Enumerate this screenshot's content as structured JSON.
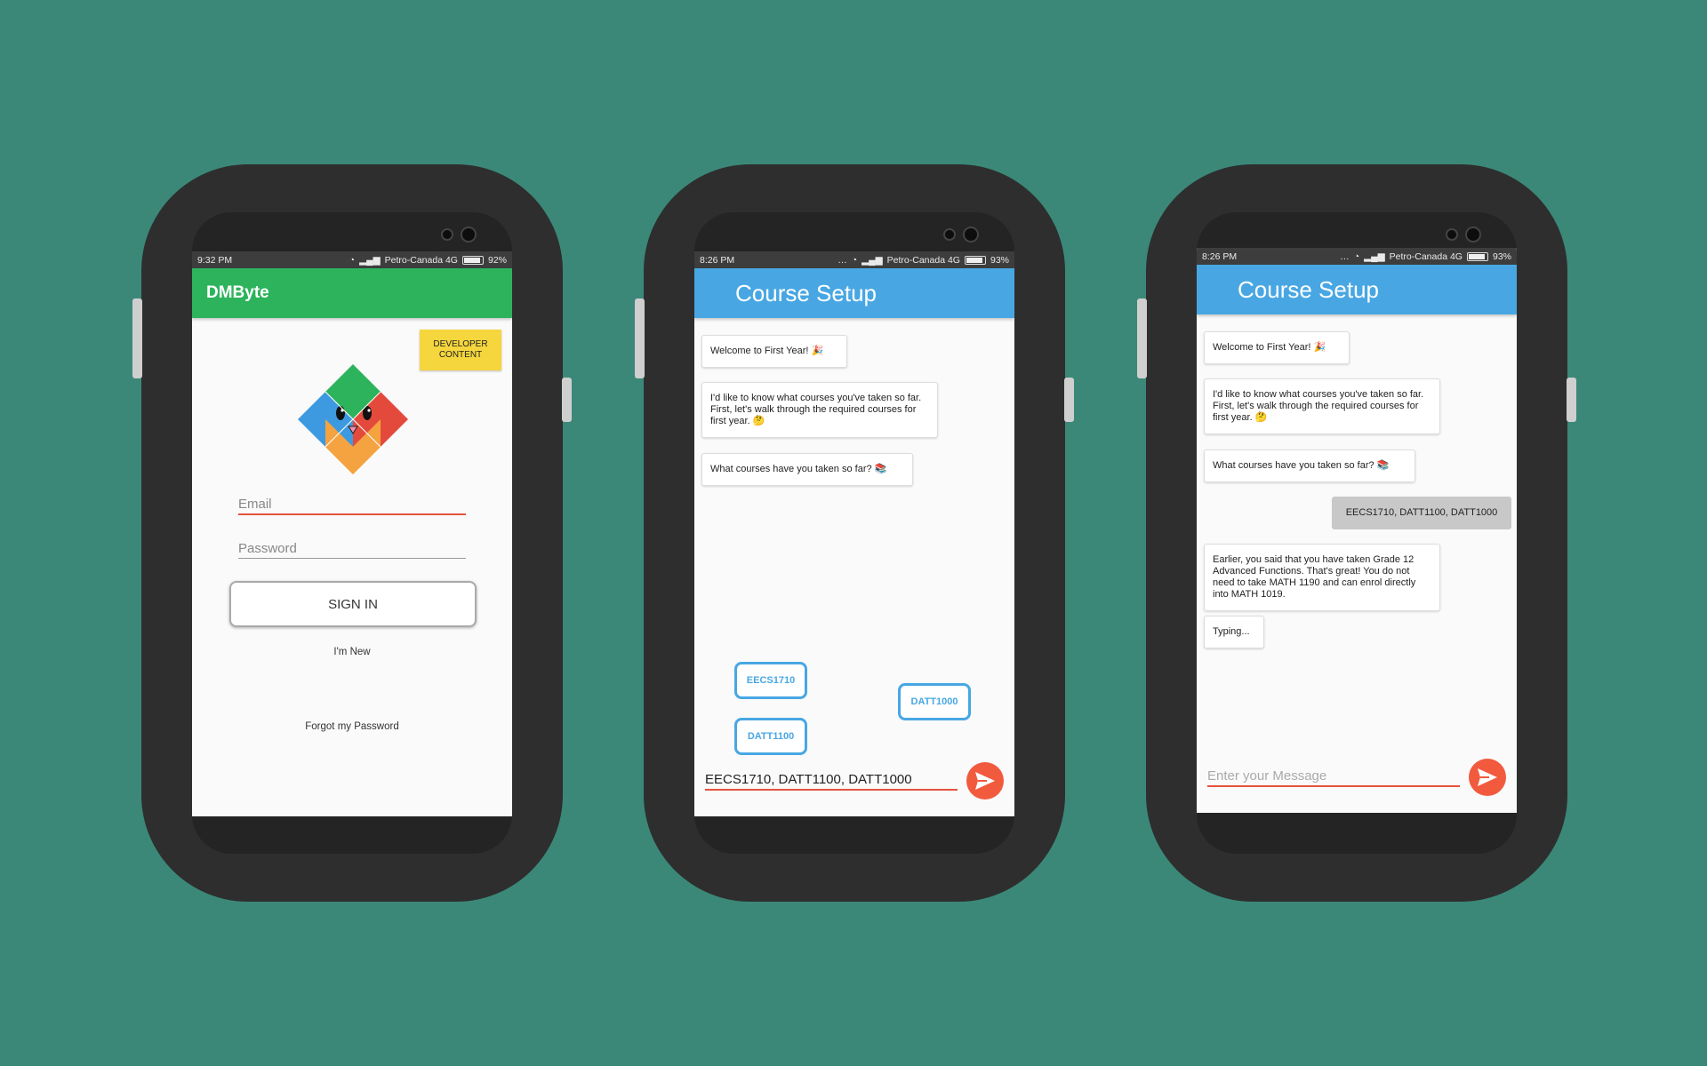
{
  "phones": [
    {
      "status": {
        "time": "9:32 PM",
        "carrier": "Petro-Canada 4G",
        "battery": "92%",
        "battery_level": 0.92
      },
      "appbar": {
        "title": "DMByte",
        "color": "#2db35c"
      },
      "developer_button": "DEVELOPER CONTENT",
      "email_placeholder": "Email",
      "password_placeholder": "Password",
      "signin_label": "SIGN IN",
      "new_link": "I'm New",
      "forgot_link": "Forgot my Password",
      "logo_icon": "diamond-mascot-icon"
    },
    {
      "status": {
        "time": "8:26 PM",
        "carrier": "Petro-Canada 4G",
        "battery": "93%",
        "battery_level": 0.93
      },
      "appbar": {
        "title": "Course Setup",
        "color": "#48a7e3"
      },
      "messages": [
        "Welcome to First Year! 🎉",
        "I'd like to know what courses you've taken so far. First, let's walk through the required courses for first year. 🤔",
        "What courses have you taken so far? 📚"
      ],
      "chips": [
        "EECS1710",
        "DATT1000",
        "DATT1100"
      ],
      "input_value": "EECS1710, DATT1100, DATT1000",
      "send_icon": "send-icon"
    },
    {
      "status": {
        "time": "8:26 PM",
        "carrier": "Petro-Canada 4G",
        "battery": "93%",
        "battery_level": 0.93
      },
      "appbar": {
        "title": "Course Setup",
        "color": "#48a7e3"
      },
      "messages": [
        "Welcome to First Year! 🎉",
        "I'd like to know what courses you've taken so far. First, let's walk through the required courses for first year. 🤔",
        "What courses have you taken so far? 📚",
        "EECS1710, DATT1100, DATT1000",
        "Earlier, you said that you have taken Grade 12 Advanced Functions. That's great! You do not need to take MATH 1190 and can enrol directly into MATH 1019.",
        "Typing..."
      ],
      "input_placeholder": "Enter your Message",
      "send_icon": "send-icon"
    }
  ],
  "colors": {
    "background": "#3b8878",
    "accent": "#f25a3e",
    "bezel": "#2e2e2e"
  }
}
